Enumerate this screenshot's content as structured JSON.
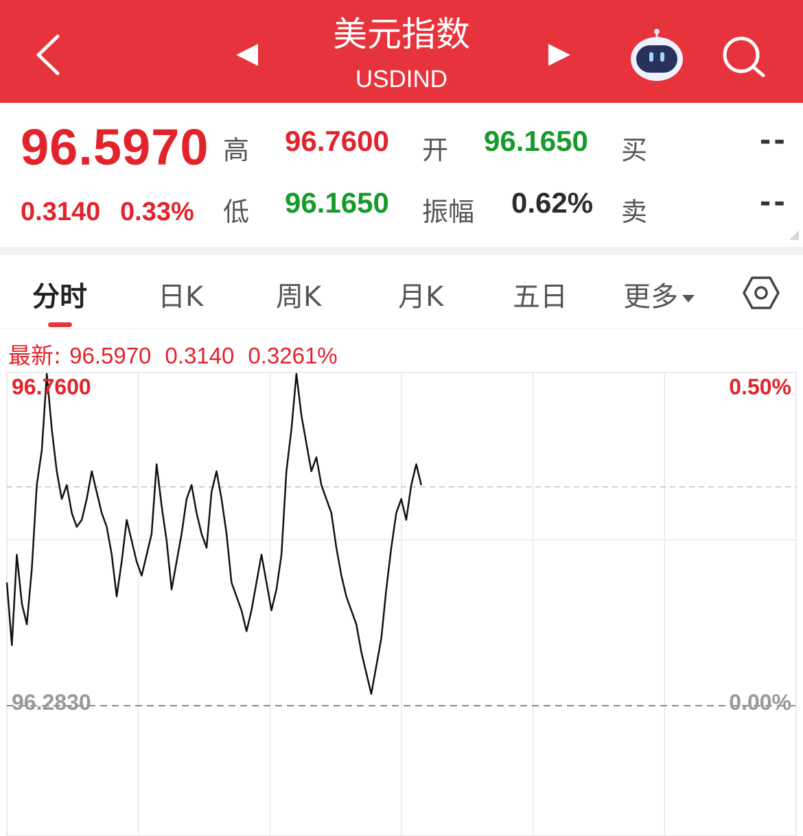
{
  "header": {
    "title": "美元指数",
    "subtitle": "USDIND",
    "bg_color": "#e7333b",
    "icons": [
      "back-icon",
      "prev-icon",
      "next-icon",
      "robot-icon",
      "search-icon"
    ]
  },
  "quote": {
    "price": "96.5970",
    "change": "0.3140",
    "change_pct": "0.33%",
    "high_label": "高",
    "high": "96.7600",
    "low_label": "低",
    "low": "96.1650",
    "open_label": "开",
    "open": "96.1650",
    "amplitude_label": "振幅",
    "amplitude": "0.62%",
    "buy_label": "买",
    "buy": "--",
    "sell_label": "卖",
    "sell": "--"
  },
  "tabs": {
    "items": [
      "分时",
      "日K",
      "周K",
      "月K",
      "五日",
      "更多"
    ],
    "active": "分时"
  },
  "latest_bar": {
    "label": "最新:",
    "price": "96.5970",
    "change": "0.3140",
    "change_pct": "0.3261%"
  },
  "chart_data": {
    "type": "line",
    "y_top_label": "96.7600",
    "y_bottom_label": "96.2830",
    "right_top_label": "0.50%",
    "right_bottom_label": "0.00%",
    "ylim": [
      96.283,
      96.76
    ],
    "x_fraction_covered": 0.525,
    "reference_dashed_level": 96.5975,
    "series": [
      {
        "values": [
          96.46,
          96.37,
          96.5,
          96.43,
          96.4,
          96.48,
          96.6,
          96.65,
          96.76,
          96.68,
          96.62,
          96.58,
          96.6,
          96.56,
          96.54,
          96.55,
          96.58,
          96.62,
          96.59,
          96.56,
          96.54,
          96.5,
          96.44,
          96.49,
          96.55,
          96.52,
          96.49,
          96.47,
          96.5,
          96.53,
          96.63,
          96.57,
          96.52,
          96.45,
          96.49,
          96.53,
          96.58,
          96.6,
          96.56,
          96.53,
          96.51,
          96.59,
          96.62,
          96.58,
          96.53,
          96.46,
          96.44,
          96.42,
          96.39,
          96.42,
          96.46,
          96.5,
          96.46,
          96.42,
          96.45,
          96.5,
          96.62,
          96.68,
          96.76,
          96.7,
          96.66,
          96.62,
          96.64,
          96.6,
          96.58,
          96.56,
          96.51,
          96.47,
          96.44,
          96.42,
          96.4,
          96.36,
          96.33,
          96.3,
          96.34,
          96.38,
          96.45,
          96.51,
          96.56,
          96.58,
          96.55,
          96.6,
          96.63,
          96.6
        ]
      }
    ]
  }
}
